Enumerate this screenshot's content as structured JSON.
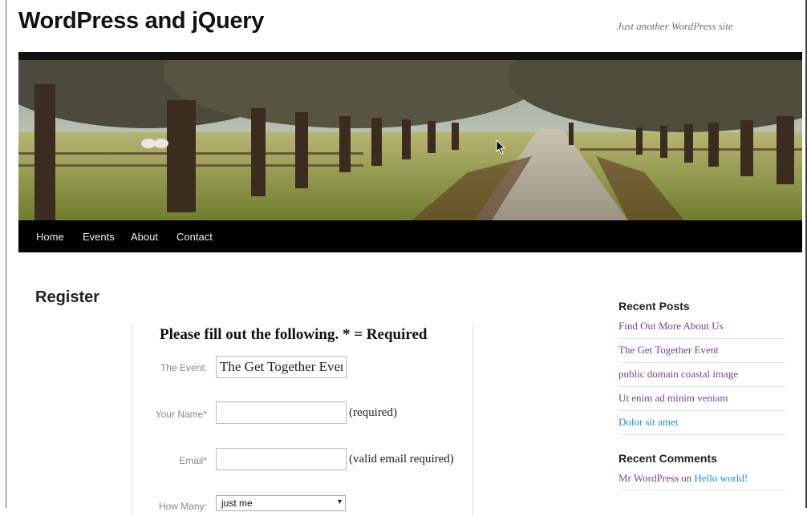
{
  "site": {
    "title": "WordPress and jQuery",
    "description": "Just another WordPress site"
  },
  "nav": {
    "items": [
      {
        "label": "Home"
      },
      {
        "label": "Events"
      },
      {
        "label": "About"
      },
      {
        "label": "Contact"
      }
    ]
  },
  "page": {
    "title": "Register"
  },
  "form": {
    "heading": "Please fill out the following. * = Required",
    "fields": {
      "event": {
        "label": "The Event:",
        "value": "The Get Together Event"
      },
      "name": {
        "label": "Your Name*",
        "value": "",
        "note": "(required)"
      },
      "email": {
        "label": "Email*",
        "value": "",
        "note": "(valid email required)"
      },
      "how_many": {
        "label": "How Many:",
        "selected": "just me"
      }
    }
  },
  "sidebar": {
    "recent_posts": {
      "title": "Recent Posts",
      "items": [
        {
          "label": "Find Out More About Us"
        },
        {
          "label": "The Get Together Event"
        },
        {
          "label": "public domain coastal image"
        },
        {
          "label": "Ut enim ad minim veniam"
        },
        {
          "label": "Dolor sit amet"
        }
      ]
    },
    "recent_comments": {
      "title": "Recent Comments",
      "author": "Mr WordPress",
      "on": "on",
      "post": "Hello world!"
    }
  },
  "colors": {
    "link_visited": "#7d3f98",
    "link": "#1b8be0",
    "nav_bg": "#000000"
  },
  "icons": {
    "mouse_cursor": "mouse-cursor-icon",
    "select_arrow": "chevron-down-icon"
  }
}
